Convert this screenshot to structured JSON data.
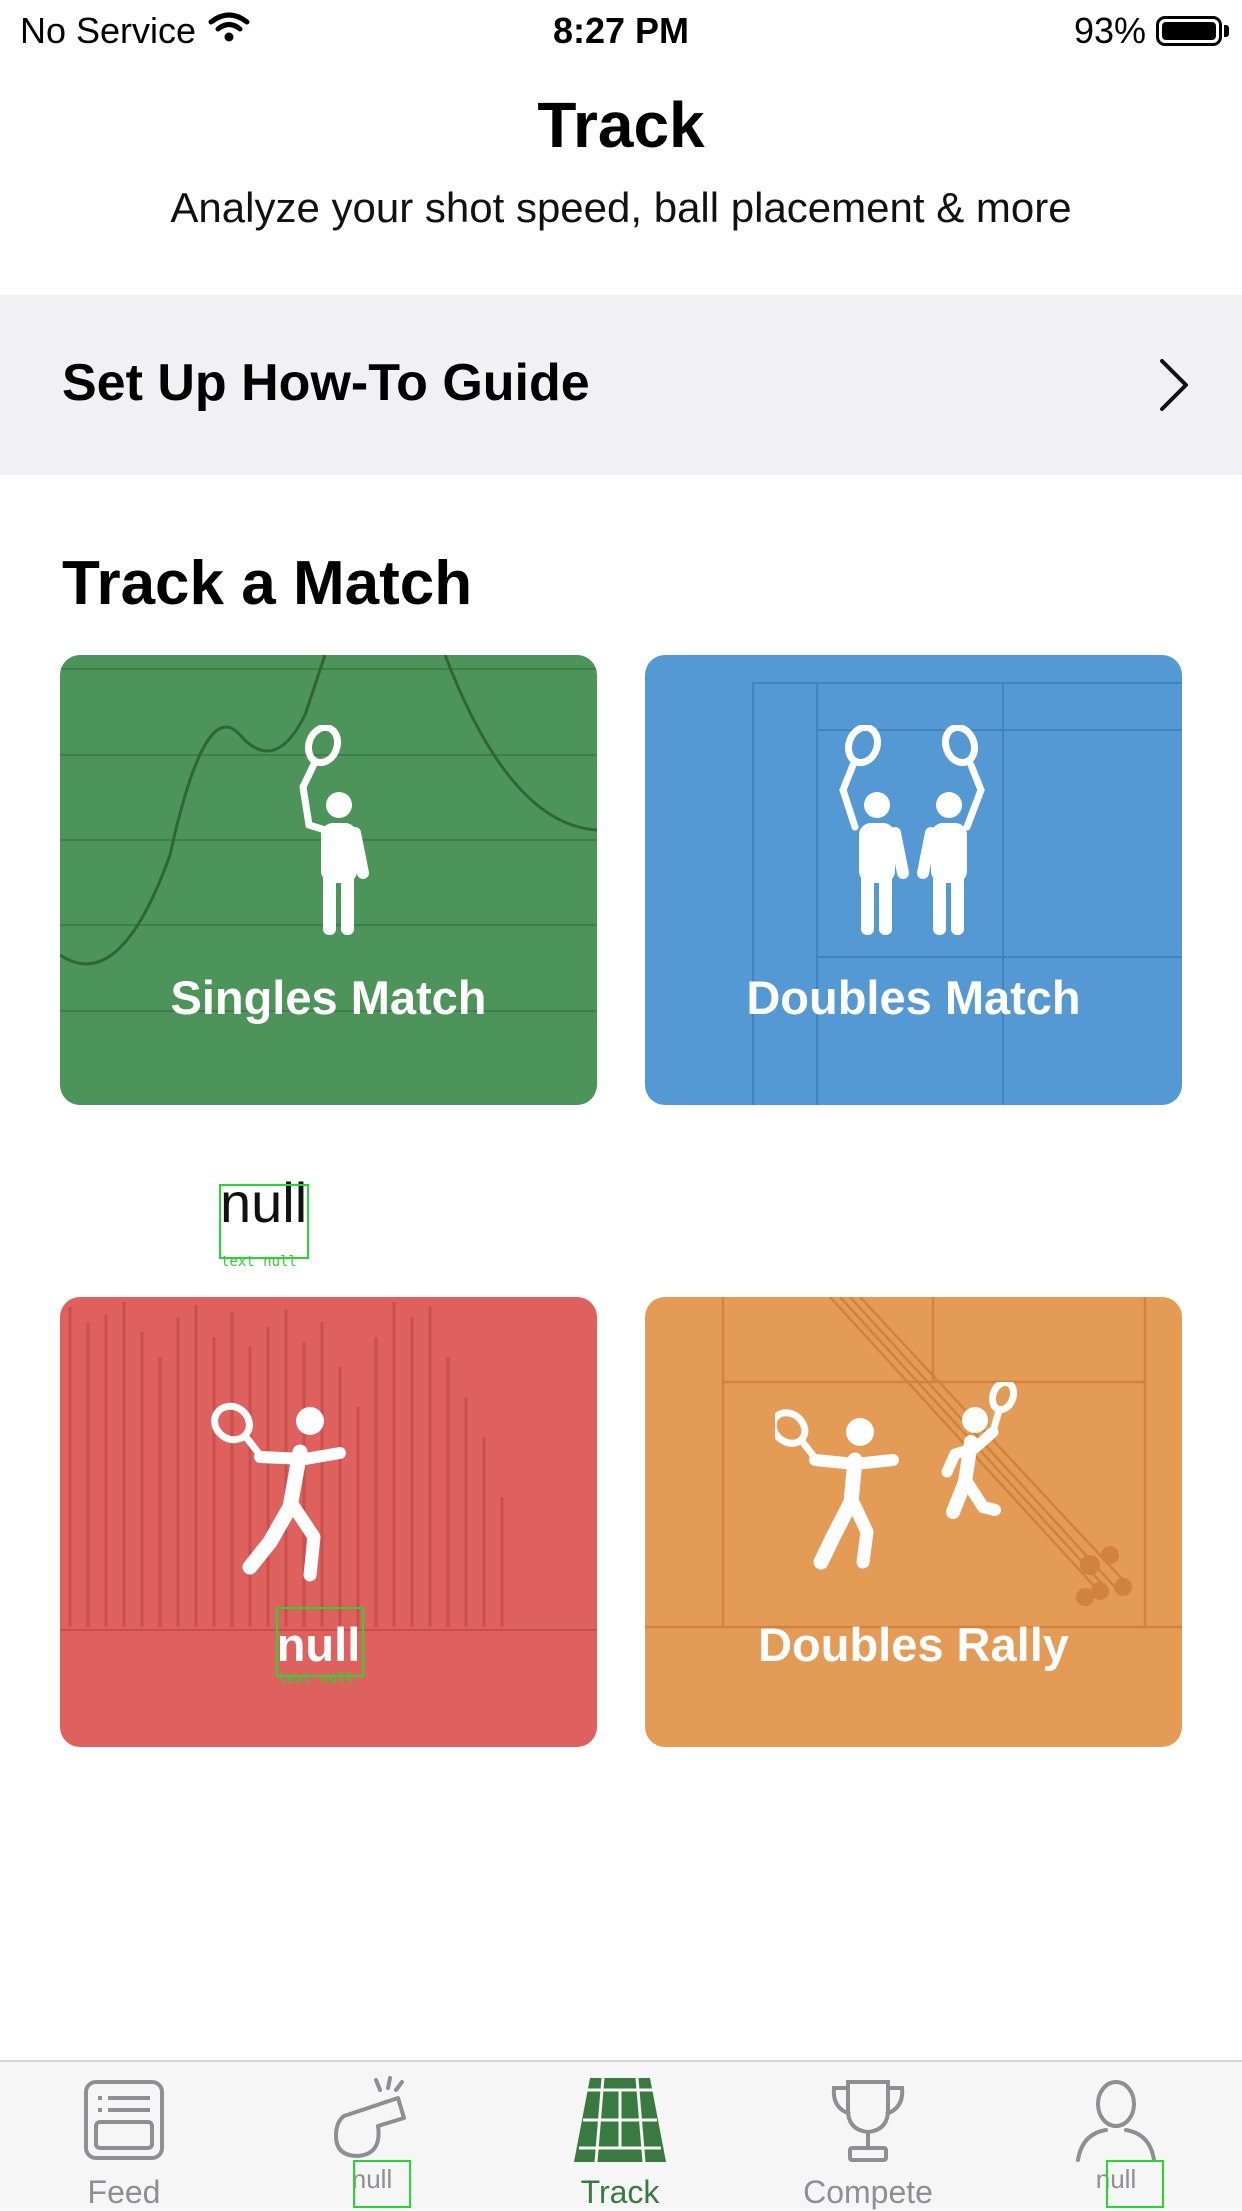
{
  "status_bar": {
    "carrier": "No Service",
    "time": "8:27 PM",
    "battery": "93%"
  },
  "header": {
    "title": "Track",
    "subtitle": "Analyze your shot speed, ball placement & more"
  },
  "guide": {
    "label": "Set Up How-To Guide"
  },
  "section": {
    "title": "Track a Match"
  },
  "cards": [
    {
      "label": "Singles Match",
      "color": "#4c9459"
    },
    {
      "label": "Doubles Match",
      "color": "#5499d4"
    },
    {
      "label": "null",
      "color": "#de615d",
      "debug": "text null"
    },
    {
      "label": "Doubles Rally",
      "color": "#e49b56"
    }
  ],
  "null_row": {
    "label": "null",
    "debug": "text null"
  },
  "tab_bar": {
    "tabs": [
      {
        "label": "Feed",
        "icon": "feed-icon"
      },
      {
        "label": "null",
        "icon": "whistle-icon"
      },
      {
        "label": "Track",
        "icon": "court-icon",
        "active": true
      },
      {
        "label": "Compete",
        "icon": "trophy-icon"
      },
      {
        "label": "null",
        "icon": "profile-icon"
      }
    ],
    "active_color": "#3a7a41",
    "inactive_color": "#8e8e93"
  }
}
